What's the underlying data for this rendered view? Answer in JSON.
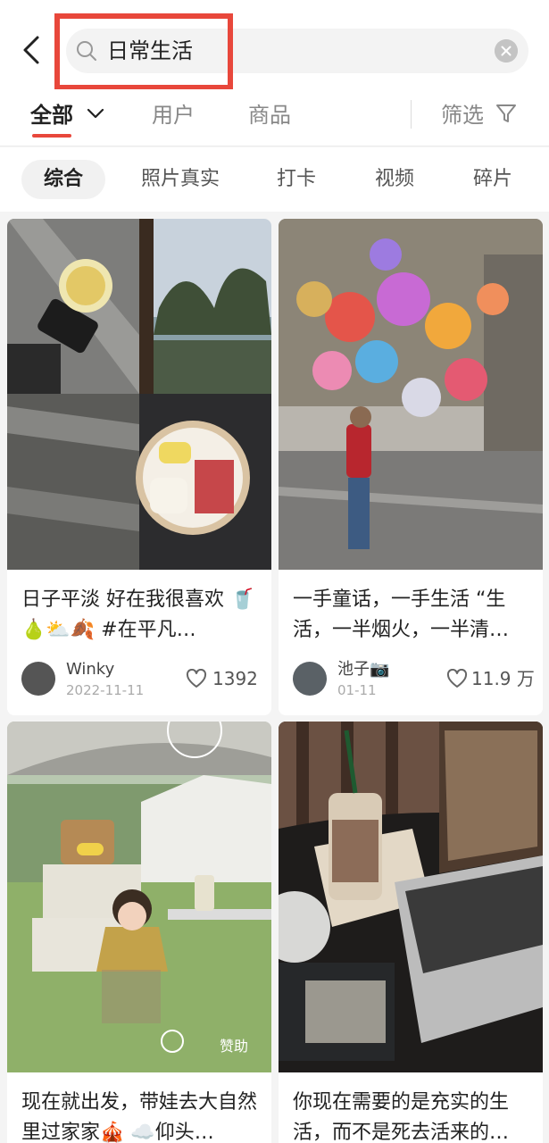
{
  "header": {
    "search_query": "日常生活",
    "back_icon": "chevron-left-icon",
    "search_icon": "search-icon",
    "clear_icon": "clear-icon",
    "highlight_color": "#e8473b"
  },
  "tabs": [
    {
      "label": "全部",
      "active": true
    },
    {
      "label": "用户"
    },
    {
      "label": "商品"
    },
    {
      "label": "筛选"
    }
  ],
  "chips": [
    {
      "label": "综合",
      "active": true
    },
    {
      "label": "照片真实"
    },
    {
      "label": "打卡"
    },
    {
      "label": "视频"
    },
    {
      "label": "碎片"
    }
  ],
  "feed": [
    {
      "caption": "日子平淡 好在我很喜欢 🥤🍐⛅🍂 #在平凡…",
      "author": "Winky",
      "date": "2022-11-11",
      "likes": "1392"
    },
    {
      "caption": "一手童话，一手生活 “生活，一半烟火，一半清…",
      "author": "池子📷",
      "date": "01-11",
      "likes": "11.9 万"
    },
    {
      "caption": "现在就出发，带娃去大自然里过家家🎪 ☁️仰头…",
      "sponsor_label": "赞助"
    },
    {
      "caption": "你现在需要的是充实的生活，而不是死去活来的…"
    }
  ]
}
